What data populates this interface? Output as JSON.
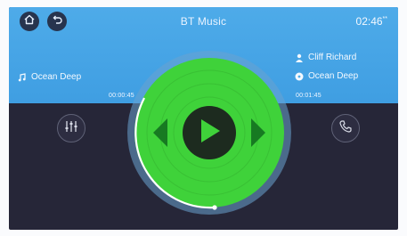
{
  "header": {
    "title": "BT Music",
    "clock": "02:46",
    "home_icon": "home-icon",
    "back_icon": "back-icon"
  },
  "track": {
    "left_song": "Ocean Deep",
    "artist": "Cliff Richard",
    "album_song": "Ocean Deep"
  },
  "progress": {
    "elapsed": "00:00:45",
    "total": "00:01:45",
    "fraction": 0.43
  },
  "controls": {
    "equalizer_icon": "equalizer-icon",
    "phone_icon": "phone-icon",
    "play_icon": "play-icon",
    "prev_icon": "previous-icon",
    "next_icon": "next-icon"
  },
  "colors": {
    "header_blue": "#4eabe9",
    "disc_green": "#3fd23a",
    "background": "#262638"
  }
}
